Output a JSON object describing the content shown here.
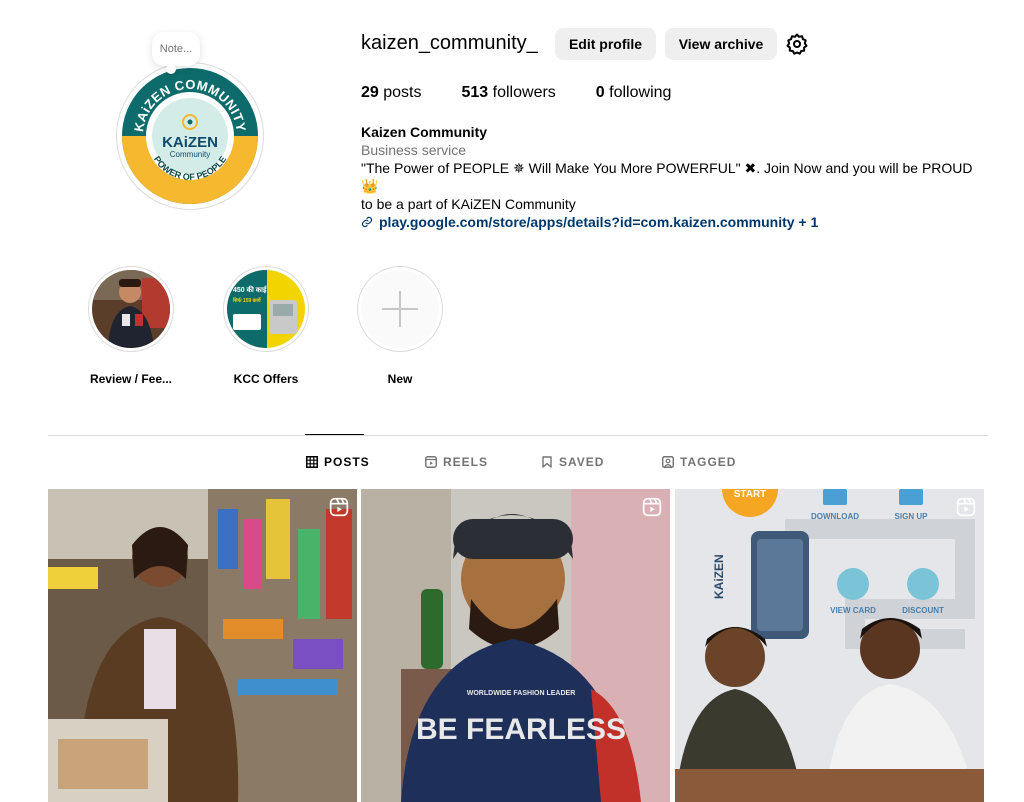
{
  "profile": {
    "username": "kaizen_community_",
    "note": "Note...",
    "edit_profile": "Edit profile",
    "view_archive": "View archive",
    "avatar_text": {
      "top": "KAiZEN COMMUNITY",
      "center": "KAiZEN",
      "center_sub": "Community",
      "bottom": "POWER OF PEOPLE"
    }
  },
  "stats": {
    "posts_count": "29",
    "posts_label": "posts",
    "followers_count": "513",
    "followers_label": "followers",
    "following_count": "0",
    "following_label": "following"
  },
  "bio": {
    "name": "Kaizen Community",
    "category": "Business service",
    "text_line1": "\"The Power of PEOPLE ✵  Will Make You More POWERFUL\" ✖. Join Now and you will be PROUD 👑",
    "text_line2": "to be a part of KAiZEN Community",
    "link": "play.google.com/store/apps/details?id=com.kaizen.community + 1"
  },
  "highlights": [
    {
      "label": "Review / Fee..."
    },
    {
      "label": "KCC Offers"
    },
    {
      "label": "New"
    }
  ],
  "highlight_thumb_text": {
    "line1": "450 की काई",
    "line2": "सिर्फ 159 कार्ये"
  },
  "tabs": {
    "posts": "POSTS",
    "reels": "REELS",
    "saved": "SAVED",
    "tagged": "TAGGED"
  },
  "posts": {
    "post2_shirt_text": "BE FEARLESS",
    "post2_shirt_sub": "WORLDWIDE FASHION LEADER",
    "post3_labels": {
      "start": "START",
      "download": "DOWNLOAD",
      "signup": "SIGN UP",
      "viewcard": "VIEW CARD",
      "discount": "DISCOUNT",
      "brand": "KAiZEN"
    }
  },
  "colors": {
    "brand_teal": "#0e6b6b",
    "brand_yellow": "#f5b82e",
    "link": "#00376b",
    "muted": "#737373",
    "button_bg": "#efefef"
  }
}
